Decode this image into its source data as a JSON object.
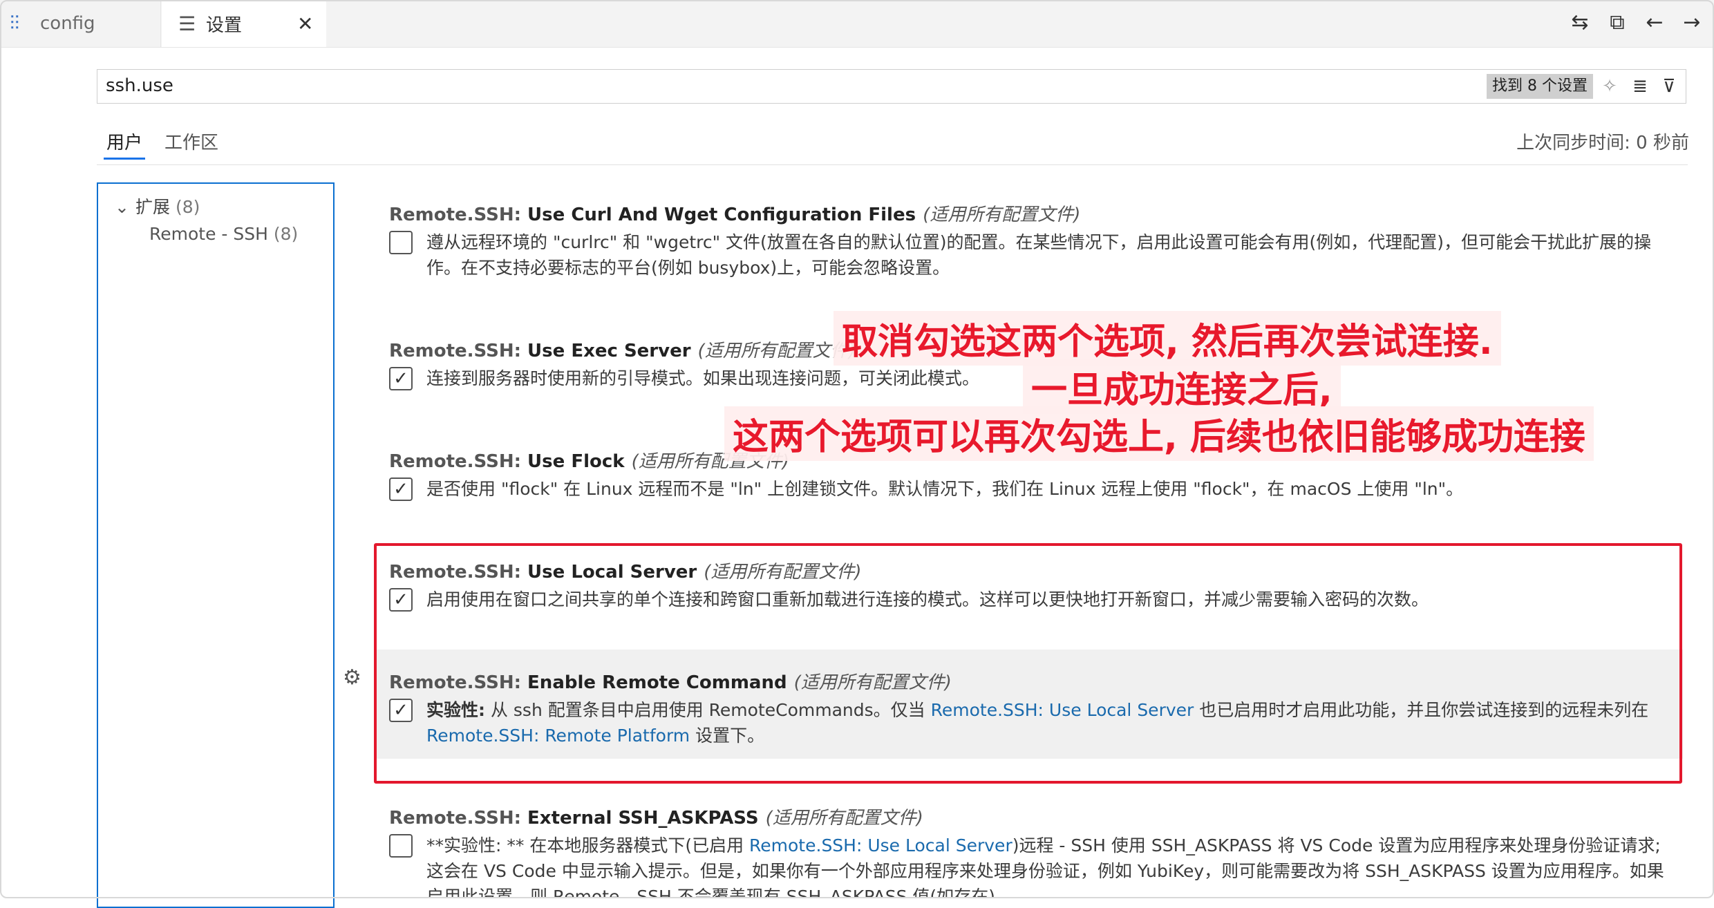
{
  "tabs": [
    {
      "label": "config",
      "icon": "source-control-icon"
    },
    {
      "label": "设置",
      "icon": "settings-icon",
      "close": "✕"
    }
  ],
  "actions": [
    "compare-icon",
    "open-file-icon",
    "arrow-left-icon",
    "arrow-right-icon"
  ],
  "search": {
    "value": "ssh.use",
    "result_count": "找到 8 个设置"
  },
  "scope_tabs": {
    "user": "用户",
    "workspace": "工作区"
  },
  "sync_status": "上次同步时间: 0 秒前",
  "toc": {
    "extensions": {
      "label": "扩展",
      "count": "(8)"
    },
    "remote_ssh": {
      "label": "Remote - SSH",
      "count": "(8)"
    }
  },
  "settings": [
    {
      "category": "Remote.SSH: ",
      "name": "Use Curl And Wget Configuration Files",
      "scope_note": "(适用所有配置文件)",
      "checked": false,
      "description": "遵从远程环境的 \"curlrc\" 和 \"wgetrc\" 文件(放置在各自的默认位置)的配置。在某些情况下，启用此设置可能会有用(例如，代理配置)，但可能会干扰此扩展的操作。在不支持必要标志的平台(例如 busybox)上，可能会忽略设置。"
    },
    {
      "category": "Remote.SSH: ",
      "name": "Use Exec Server",
      "scope_note": "(适用所有配置文件)",
      "checked": true,
      "description": "连接到服务器时使用新的引导模式。如果出现连接问题，可关闭此模式。"
    },
    {
      "category": "Remote.SSH: ",
      "name": "Use Flock",
      "scope_note": "(适用所有配置文件)",
      "checked": true,
      "description": "是否使用 \"flock\" 在 Linux 远程而不是 \"ln\" 上创建锁文件。默认情况下，我们在 Linux 远程上使用 \"flock\"，在 macOS 上使用 \"ln\"。"
    },
    {
      "category": "Remote.SSH: ",
      "name": "Use Local Server",
      "scope_note": "(适用所有配置文件)",
      "checked": true,
      "description": "启用使用在窗口之间共享的单个连接和跨窗口重新加载进行连接的模式。这样可以更快地打开新窗口，并减少需要输入密码的次数。"
    },
    {
      "category": "Remote.SSH: ",
      "name": "Enable Remote Command",
      "scope_note": "(适用所有配置文件)",
      "checked": true,
      "desc_strong": "实验性:",
      "desc_a": " 从 ssh 配置条目中启用使用 RemoteCommands。仅当 ",
      "desc_link1": "Remote.SSH: Use Local Server",
      "desc_b": " 也已启用时才启用此功能，并且你尝试连接到的远程未列在 ",
      "desc_link2": "Remote.SSH: Remote Platform",
      "desc_c": " 设置下。"
    },
    {
      "category": "Remote.SSH: ",
      "name": "External SSH_ASKPASS",
      "scope_note": "(适用所有配置文件)",
      "checked": false,
      "desc_a": "**实验性: ** 在本地服务器模式下(已启用 ",
      "desc_link1": "Remote.SSH: Use Local Server",
      "desc_b": ")远程 - SSH 使用 SSH_ASKPASS 将 VS Code 设置为应用程序来处理身份验证请求; 这会在 VS Code 中显示输入提示。但是，如果你有一个外部应用程序来处理身份验证，例如 YubiKey，则可能需要改为将 SSH_ASKPASS 设置为应用程序。如果启用此设置，则 Remote - SSH 不会覆盖现有 SSH_ASKPASS 值(如存在)。"
    }
  ],
  "annotation": {
    "line1": "取消勾选这两个选项, 然后再次尝试连接.",
    "line2": "一旦成功连接之后,",
    "line3": "这两个选项可以再次勾选上, 后续也依旧能够成功连接"
  },
  "colors": {
    "accent": "#0a6fd0",
    "annotation": "#e8192c",
    "link": "#1a6aad"
  }
}
